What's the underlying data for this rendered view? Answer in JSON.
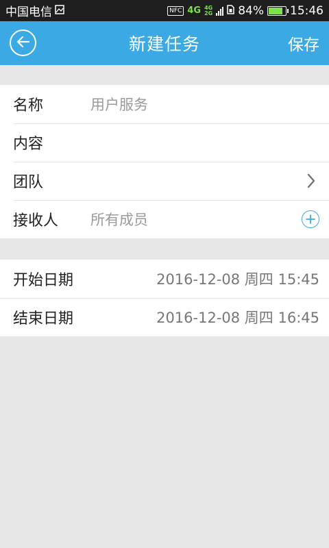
{
  "status_bar": {
    "carrier": "中国电信",
    "nfc": "NFC",
    "network_4g": "4G",
    "network_stack_top": "4G",
    "network_stack_bottom": "2G",
    "battery": "84%",
    "time": "15:46",
    "battery_level": 0.84
  },
  "header": {
    "back_icon": "back-arrow-icon",
    "title": "新建任务",
    "save_label": "保存"
  },
  "form": {
    "name": {
      "label": "名称",
      "placeholder": "用户服务"
    },
    "content": {
      "label": "内容"
    },
    "team": {
      "label": "团队",
      "icon": "chevron-right-icon"
    },
    "recipient": {
      "label": "接收人",
      "value": "所有成员",
      "icon": "add-circle-icon"
    }
  },
  "dates": {
    "start": {
      "label": "开始日期",
      "value": "2016-12-08 周四 15:45"
    },
    "end": {
      "label": "结束日期",
      "value": "2016-12-08 周四 16:45"
    }
  },
  "colors": {
    "accent": "#3aa9e4",
    "background": "#e6e6e6",
    "status_bar": "#1e1e1e"
  }
}
